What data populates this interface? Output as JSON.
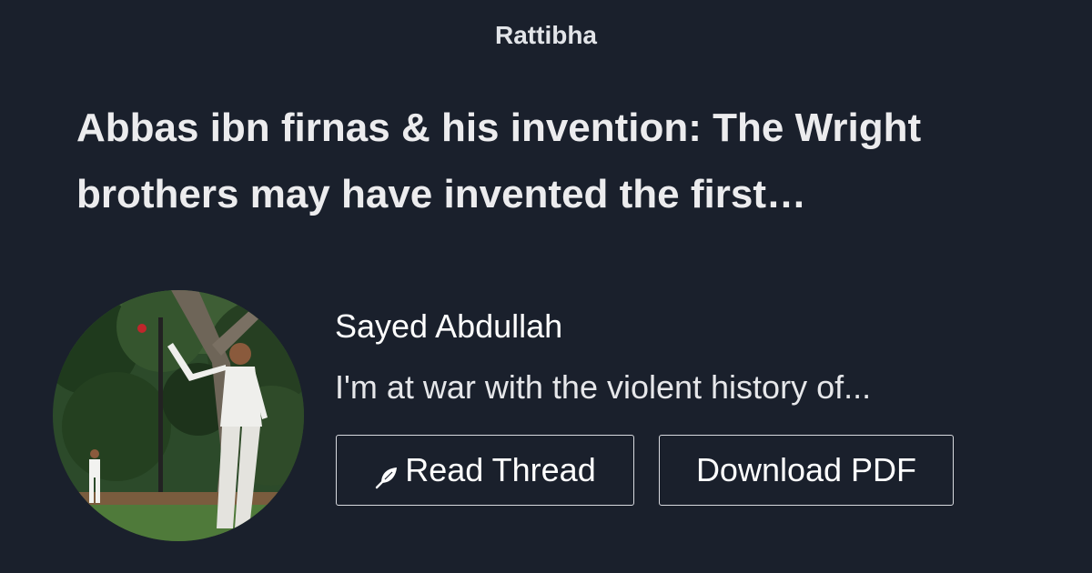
{
  "brand": "Rattibha",
  "thread": {
    "title": "Abbas ibn firnas & his invention: The Wright brothers may have invented the first…"
  },
  "author": {
    "name": "Sayed Abdullah",
    "bio": "I'm at war with the violent history of..."
  },
  "buttons": {
    "read_thread": "Read Thread",
    "download_pdf": "Download PDF"
  },
  "icons": {
    "read_thread": "feather-icon"
  },
  "colors": {
    "background": "#1a202c",
    "text": "#ffffff",
    "button_border": "#d8dadf"
  }
}
